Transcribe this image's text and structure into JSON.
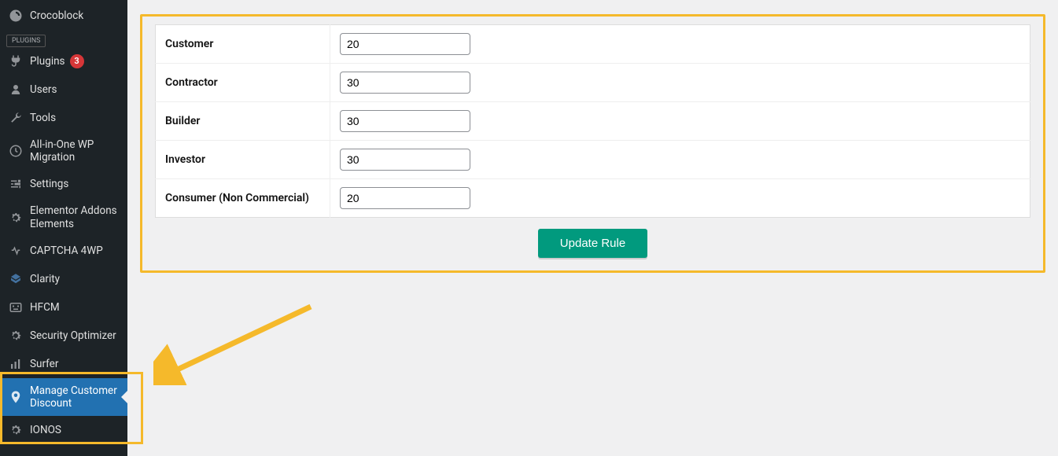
{
  "sidebar": {
    "section_label": "PLUGINS",
    "items": [
      {
        "label": "Crocoblock"
      },
      {
        "label": "Plugins",
        "badge": "3"
      },
      {
        "label": "Users"
      },
      {
        "label": "Tools"
      },
      {
        "label": "All-in-One WP Migration"
      },
      {
        "label": "Settings"
      },
      {
        "label": "Elementor Addons Elements"
      },
      {
        "label": "CAPTCHA 4WP"
      },
      {
        "label": "Clarity"
      },
      {
        "label": "HFCM"
      },
      {
        "label": "Security Optimizer"
      },
      {
        "label": "Surfer"
      },
      {
        "label": "Manage Customer Discount"
      },
      {
        "label": "IONOS"
      }
    ]
  },
  "rules": [
    {
      "label": "Customer",
      "value": "20"
    },
    {
      "label": "Contractor",
      "value": "30"
    },
    {
      "label": "Builder",
      "value": "30"
    },
    {
      "label": "Investor",
      "value": "30"
    },
    {
      "label": "Consumer (Non Commercial)",
      "value": "20"
    }
  ],
  "buttons": {
    "update": "Update Rule"
  }
}
